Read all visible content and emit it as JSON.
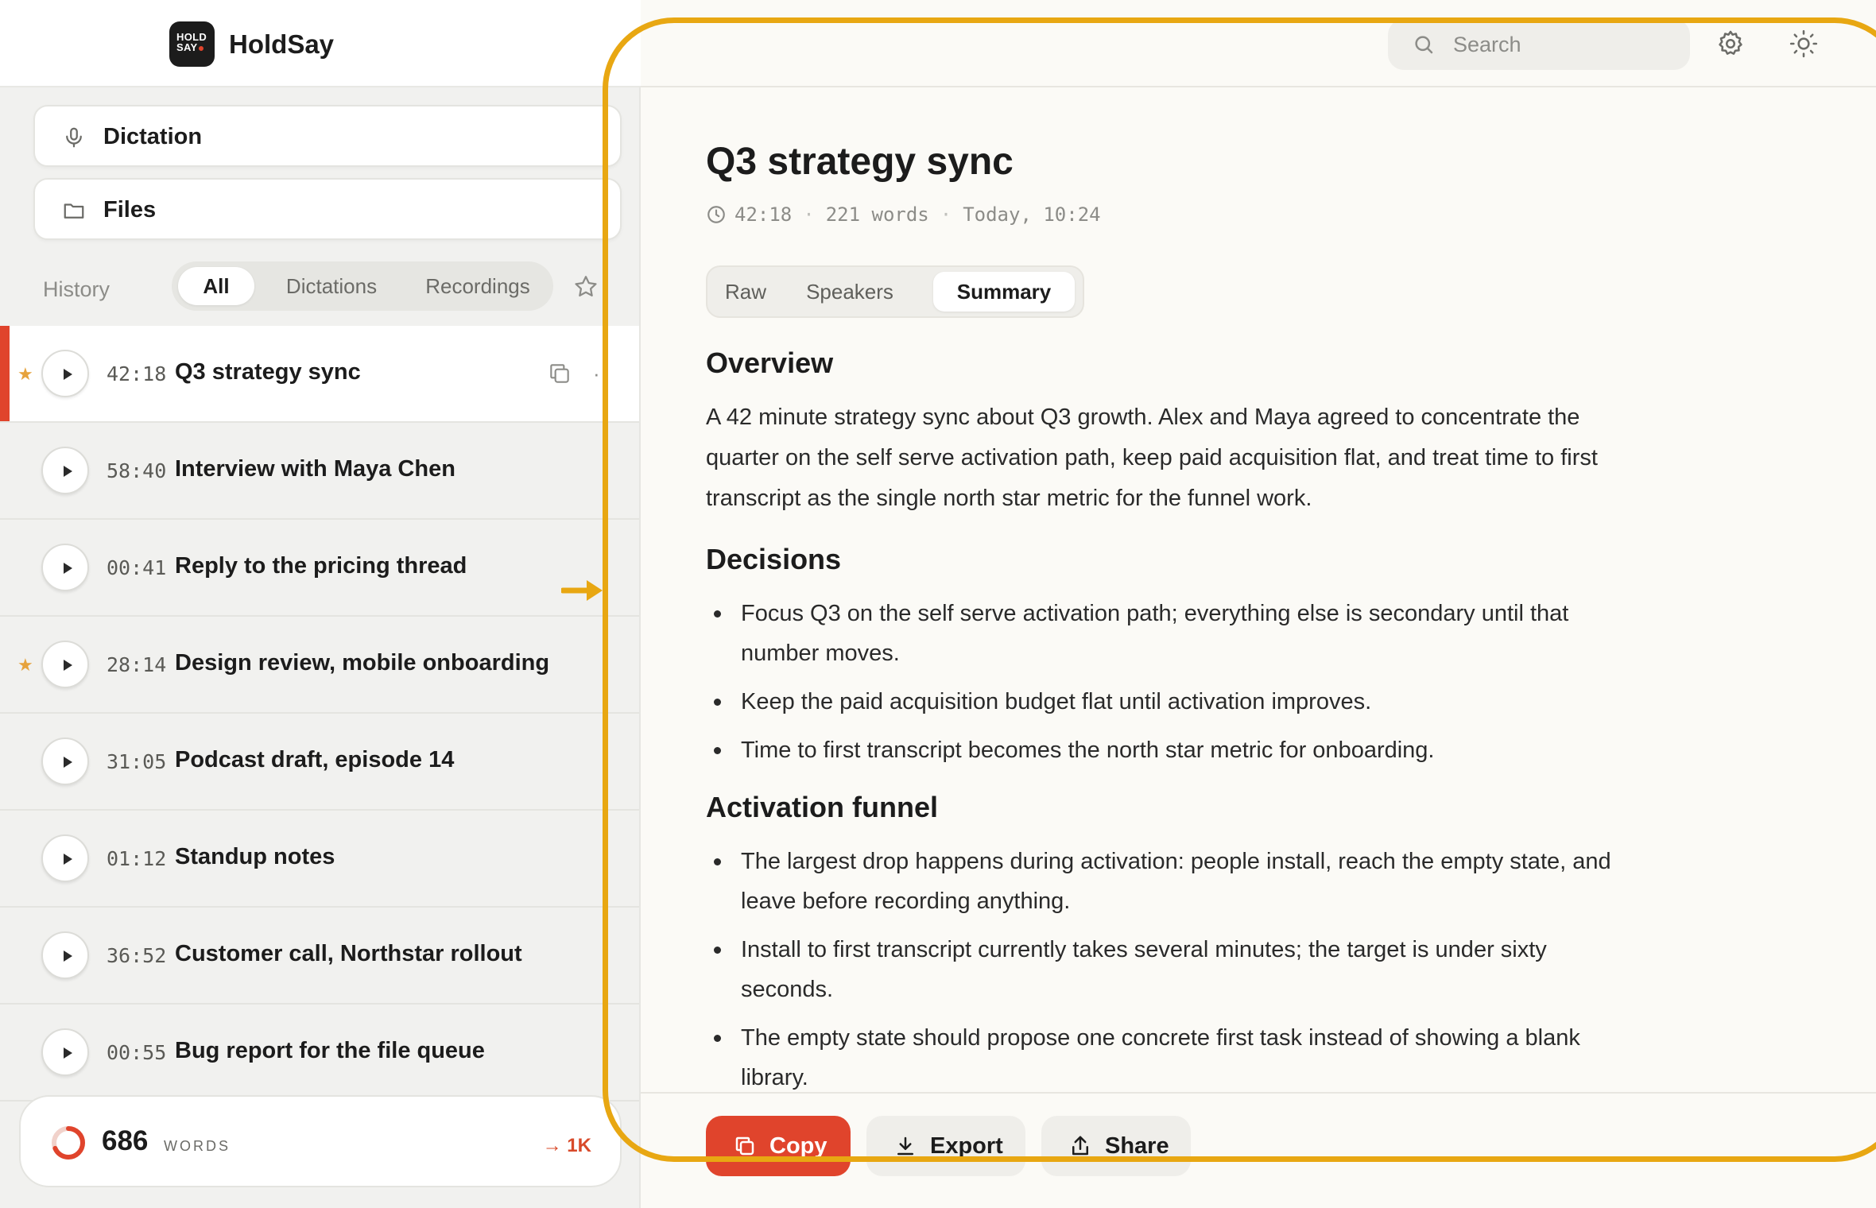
{
  "app": {
    "logo_text_line1": "HOLD",
    "logo_text_line2": "SAY",
    "name": "HoldSay"
  },
  "sidebar": {
    "nav": [
      {
        "label": "Dictation",
        "icon": "microphone-icon"
      },
      {
        "label": "Files",
        "icon": "folder-icon"
      }
    ],
    "history_label": "History",
    "filters": [
      {
        "label": "All",
        "active": true
      },
      {
        "label": "Dictations",
        "active": false
      },
      {
        "label": "Recordings",
        "active": false
      }
    ],
    "favorites_filter_icon": "star-outline-icon",
    "items": [
      {
        "duration": "42:18",
        "title": "Q3 strategy sync",
        "starred": true,
        "active": true
      },
      {
        "duration": "58:40",
        "title": "Interview with Maya Chen",
        "starred": false,
        "active": false
      },
      {
        "duration": "00:41",
        "title": "Reply to the pricing thread",
        "starred": false,
        "active": false
      },
      {
        "duration": "28:14",
        "title": "Design review, mobile onboarding",
        "starred": true,
        "active": false
      },
      {
        "duration": "31:05",
        "title": "Podcast draft, episode 14",
        "starred": false,
        "active": false
      },
      {
        "duration": "01:12",
        "title": "Standup notes",
        "starred": false,
        "active": false
      },
      {
        "duration": "36:52",
        "title": "Customer call, Northstar rollout",
        "starred": false,
        "active": false
      },
      {
        "duration": "00:55",
        "title": "Bug report for the file queue",
        "starred": false,
        "active": false
      }
    ],
    "word_counter": {
      "count": "686",
      "label": "WORDS",
      "goal": "→ 1K",
      "progress": 0.686
    }
  },
  "topbar": {
    "search_placeholder": "Search",
    "settings_icon": "gear-icon",
    "theme_icon": "sun-icon"
  },
  "document": {
    "title": "Q3 strategy sync",
    "duration": "42:18",
    "words": "221 words",
    "timestamp": "Today, 10:24",
    "tabs": [
      {
        "label": "Raw",
        "active": false
      },
      {
        "label": "Speakers",
        "active": false
      },
      {
        "label": "Summary",
        "active": true
      }
    ],
    "sections": [
      {
        "heading": "Overview"
      },
      {
        "heading": "Decisions"
      },
      {
        "heading": "Activation funnel"
      }
    ],
    "overview_text": "A 42 minute strategy sync about Q3 growth. Alex and Maya agreed to concentrate the quarter on the self serve activation path, keep paid acquisition flat, and treat time to first transcript as the single north star metric for the funnel work.",
    "decisions": [
      "Focus Q3 on the self serve activation path; everything else is secondary until that number moves.",
      "Keep the paid acquisition budget flat until activation improves.",
      "Time to first transcript becomes the north star metric for onboarding."
    ],
    "funnel": [
      "The largest drop happens during activation: people install, reach the empty state, and leave before recording anything.",
      "Install to first transcript currently takes several minutes; the target is under sixty seconds.",
      "The empty state should propose one concrete first task instead of showing a blank library."
    ]
  },
  "footer": {
    "copy_label": "Copy",
    "export_label": "Export",
    "share_label": "Share"
  },
  "colors": {
    "accent": "#e0442c",
    "highlight": "#e8a712",
    "star": "#e6a23c"
  }
}
